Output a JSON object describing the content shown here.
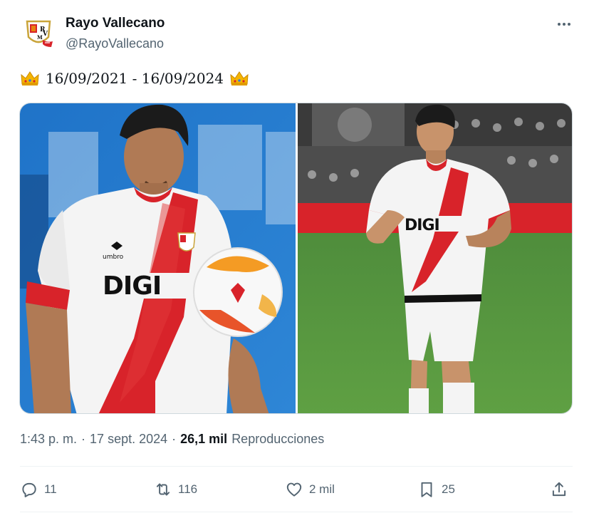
{
  "author": {
    "display_name": "Rayo Vallecano",
    "handle": "@RayoVallecano",
    "avatar_icon": "rayo-vallecano-crest-icon"
  },
  "tweet": {
    "text": "16/09/2021 - 16/09/2024",
    "emoji_icon": "crown-icon"
  },
  "media": [
    {
      "name": "photo-player-left",
      "sponsor_text": "DIGI",
      "kit_brand": "umbro"
    },
    {
      "name": "photo-player-right",
      "sponsor_text": "DIGI",
      "kit_brand": "umbro"
    }
  ],
  "meta": {
    "time": "1:43 p. m.",
    "date": "17 sept. 2024",
    "views": "26,1 mil",
    "views_label": "Reproducciones"
  },
  "actions": {
    "replies": "11",
    "reposts": "116",
    "likes": "2 mil",
    "bookmarks": "25"
  },
  "colors": {
    "text_primary": "#0f1419",
    "text_secondary": "#536471",
    "border": "#cfd9de",
    "rayo_red": "#d8232a"
  }
}
